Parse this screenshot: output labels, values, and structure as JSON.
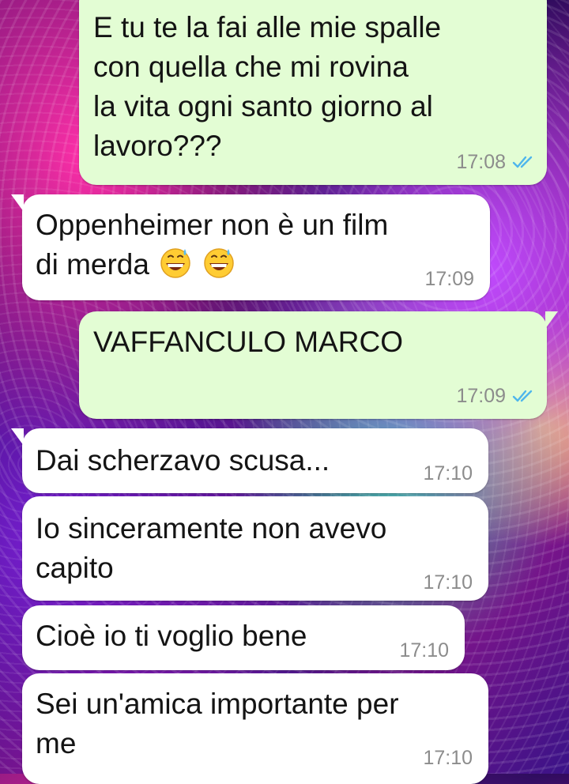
{
  "messages": [
    {
      "direction": "outgoing",
      "lines": [
        "E tu te la fai alle mie spalle",
        "con quella che mi rovina",
        "la vita ogni santo giorno al",
        "lavoro???"
      ],
      "time": "17:08",
      "status": "read-double-check-icon"
    },
    {
      "direction": "incoming",
      "lines": [
        "Oppenheimer non è un film",
        "di merda"
      ],
      "emoji": [
        "grinning-sweat-emoji",
        "grinning-sweat-emoji"
      ],
      "time": "17:09"
    },
    {
      "direction": "outgoing",
      "lines": [
        "VAFFANCULO MARCO"
      ],
      "time": "17:09",
      "status": "read-double-check-icon"
    },
    {
      "direction": "incoming",
      "lines": [
        "Dai scherzavo scusa..."
      ],
      "time": "17:10"
    },
    {
      "direction": "incoming",
      "lines": [
        "Io sinceramente non avevo",
        "capito"
      ],
      "time": "17:10"
    },
    {
      "direction": "incoming",
      "lines": [
        "Cioè io ti voglio bene"
      ],
      "time": "17:10"
    },
    {
      "direction": "incoming",
      "lines": [
        "Sei un'amica importante per",
        "me"
      ],
      "time": "17:10"
    }
  ],
  "colors": {
    "outgoing_bubble": "#e3fdd4",
    "incoming_bubble": "#ffffff",
    "read_tick": "#4fb6ec",
    "time_text": "#8c8c8c"
  }
}
